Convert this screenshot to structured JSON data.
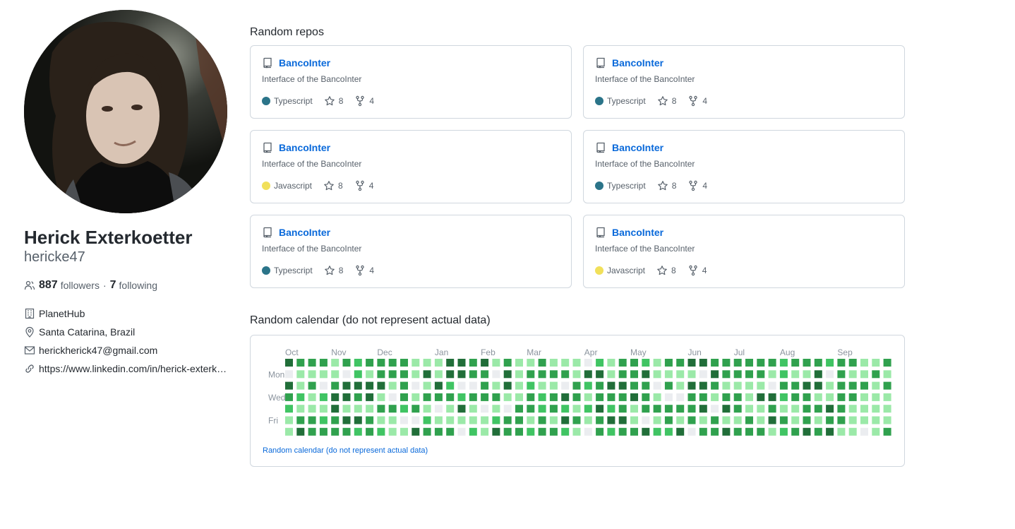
{
  "profile": {
    "fullname": "Herick Exterkoetter",
    "username": "hericke47",
    "followers_count": "887",
    "followers_label": "followers",
    "separator": "·",
    "following_count": "7",
    "following_label": "following",
    "company": "PlanetHub",
    "location": "Santa Catarina, Brazil",
    "email": "herickherick47@gmail.com",
    "website": "https://www.linkedin.com/in/herick-exterkoetter"
  },
  "repos_section": {
    "title": "Random repos",
    "repos": [
      {
        "name": "BancoInter",
        "description": "Interface of the BancoInter",
        "language": "Typescript",
        "language_color": "#2b7489",
        "stars": "8",
        "forks": "4"
      },
      {
        "name": "BancoInter",
        "description": "Interface of the BancoInter",
        "language": "Typescript",
        "language_color": "#2b7489",
        "stars": "8",
        "forks": "4"
      },
      {
        "name": "BancoInter",
        "description": "Interface of the BancoInter",
        "language": "Javascript",
        "language_color": "#f1e05a",
        "stars": "8",
        "forks": "4"
      },
      {
        "name": "BancoInter",
        "description": "Interface of the BancoInter",
        "language": "Typescript",
        "language_color": "#2b7489",
        "stars": "8",
        "forks": "4"
      },
      {
        "name": "BancoInter",
        "description": "Interface of the BancoInter",
        "language": "Typescript",
        "language_color": "#2b7489",
        "stars": "8",
        "forks": "4"
      },
      {
        "name": "BancoInter",
        "description": "Interface of the BancoInter",
        "language": "Javascript",
        "language_color": "#f1e05a",
        "stars": "8",
        "forks": "4"
      }
    ]
  },
  "calendar": {
    "title": "Random calendar (do not represent actual data)",
    "footer": "Random calendar (do not represent actual data)",
    "months": [
      "Oct",
      "Nov",
      "Dec",
      "Jan",
      "Feb",
      "Mar",
      "Apr",
      "May",
      "Jun",
      "Jul",
      "Aug",
      "Sep"
    ],
    "weekdays": [
      "Mon",
      "Wed",
      "Fri"
    ],
    "level_colors": [
      "#ebedf0",
      "#9be9a8",
      "#40c463",
      "#30a14e",
      "#216e39"
    ],
    "weeks": [
      [
        4,
        0,
        4,
        3,
        2,
        1,
        1
      ],
      [
        3,
        1,
        1,
        2,
        1,
        3,
        4
      ],
      [
        3,
        1,
        3,
        1,
        1,
        3,
        3
      ],
      [
        3,
        1,
        0,
        2,
        1,
        2,
        3
      ],
      [
        1,
        1,
        3,
        4,
        4,
        3,
        3
      ],
      [
        3,
        0,
        4,
        4,
        1,
        4,
        3
      ],
      [
        2,
        2,
        4,
        3,
        1,
        4,
        2
      ],
      [
        3,
        1,
        4,
        4,
        1,
        3,
        3
      ],
      [
        3,
        3,
        4,
        1,
        3,
        1,
        2
      ],
      [
        3,
        3,
        1,
        0,
        3,
        1,
        1
      ],
      [
        3,
        3,
        3,
        3,
        2,
        0,
        1
      ],
      [
        1,
        1,
        0,
        1,
        3,
        0,
        4
      ],
      [
        1,
        4,
        1,
        3,
        1,
        2,
        3
      ],
      [
        1,
        1,
        4,
        3,
        0,
        1,
        3
      ],
      [
        4,
        4,
        2,
        3,
        1,
        1,
        3
      ],
      [
        4,
        4,
        0,
        2,
        4,
        1,
        0
      ],
      [
        3,
        3,
        0,
        3,
        1,
        1,
        2
      ],
      [
        4,
        3,
        3,
        3,
        0,
        1,
        1
      ],
      [
        1,
        0,
        1,
        3,
        1,
        2,
        4
      ],
      [
        3,
        4,
        4,
        1,
        0,
        3,
        3
      ],
      [
        1,
        1,
        1,
        1,
        3,
        3,
        3
      ],
      [
        1,
        3,
        2,
        3,
        3,
        1,
        2
      ],
      [
        3,
        3,
        1,
        2,
        2,
        3,
        3
      ],
      [
        1,
        3,
        1,
        3,
        3,
        1,
        3
      ],
      [
        1,
        3,
        0,
        4,
        2,
        4,
        2
      ],
      [
        1,
        1,
        3,
        3,
        1,
        3,
        1
      ],
      [
        0,
        4,
        2,
        1,
        2,
        1,
        0
      ],
      [
        2,
        4,
        3,
        3,
        4,
        3,
        3
      ],
      [
        1,
        1,
        4,
        3,
        2,
        4,
        2
      ],
      [
        3,
        3,
        4,
        3,
        3,
        4,
        3
      ],
      [
        3,
        3,
        3,
        4,
        1,
        1,
        3
      ],
      [
        2,
        4,
        3,
        3,
        3,
        0,
        4
      ],
      [
        1,
        1,
        0,
        1,
        3,
        1,
        2
      ],
      [
        3,
        1,
        3,
        0,
        3,
        3,
        2
      ],
      [
        3,
        1,
        1,
        0,
        3,
        1,
        4
      ],
      [
        4,
        1,
        4,
        3,
        3,
        3,
        0
      ],
      [
        4,
        0,
        4,
        3,
        4,
        1,
        3
      ],
      [
        3,
        4,
        3,
        1,
        0,
        3,
        3
      ],
      [
        3,
        3,
        1,
        3,
        4,
        1,
        4
      ],
      [
        3,
        3,
        1,
        3,
        3,
        1,
        3
      ],
      [
        3,
        3,
        1,
        1,
        1,
        3,
        3
      ],
      [
        3,
        3,
        1,
        4,
        1,
        1,
        3
      ],
      [
        3,
        1,
        0,
        4,
        3,
        4,
        1
      ],
      [
        2,
        2,
        3,
        2,
        1,
        3,
        2
      ],
      [
        3,
        1,
        3,
        3,
        1,
        1,
        3
      ],
      [
        3,
        1,
        4,
        3,
        3,
        3,
        4
      ],
      [
        3,
        4,
        4,
        1,
        3,
        1,
        3
      ],
      [
        2,
        0,
        1,
        1,
        4,
        3,
        4
      ],
      [
        3,
        3,
        3,
        3,
        3,
        3,
        1
      ],
      [
        3,
        1,
        3,
        3,
        1,
        1,
        1
      ],
      [
        1,
        1,
        3,
        1,
        1,
        1,
        0
      ],
      [
        1,
        3,
        1,
        1,
        1,
        1,
        1
      ],
      [
        3,
        1,
        3,
        1,
        1,
        1,
        3
      ]
    ]
  }
}
